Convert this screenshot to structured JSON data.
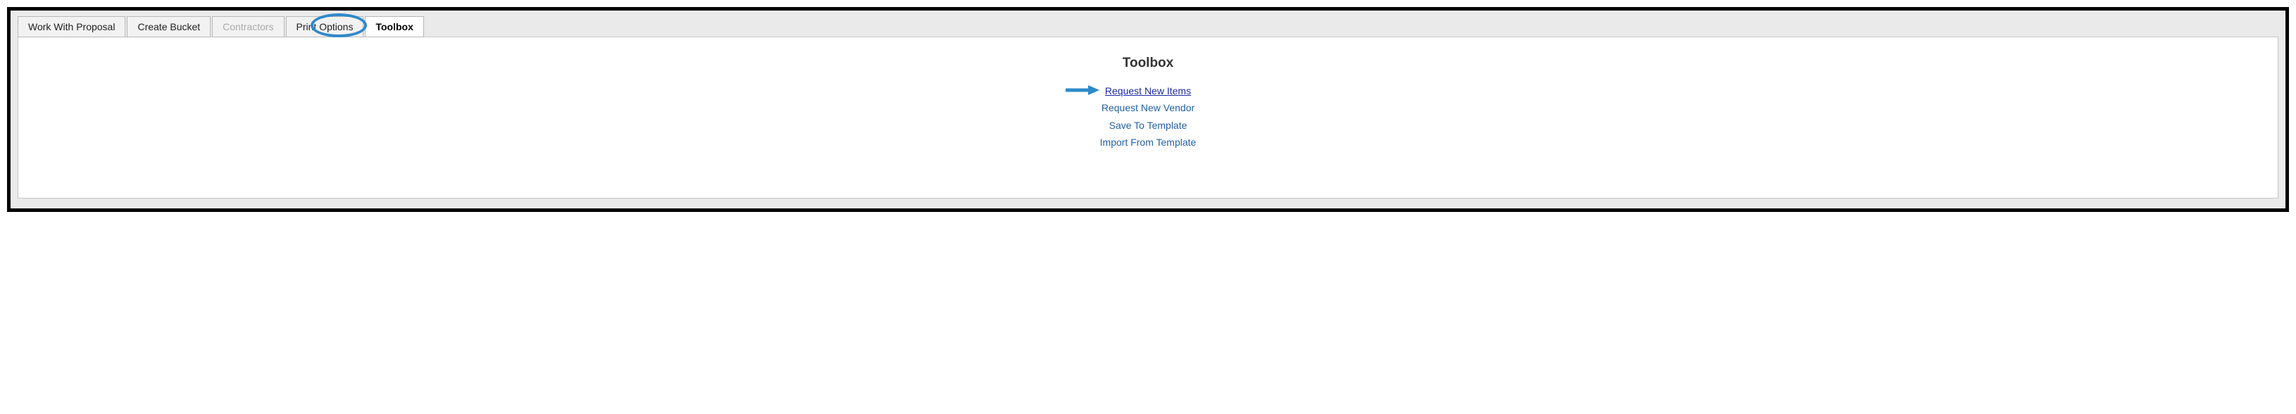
{
  "tabs": [
    {
      "label": "Work With Proposal",
      "state": "normal"
    },
    {
      "label": "Create Bucket",
      "state": "normal"
    },
    {
      "label": "Contractors",
      "state": "disabled"
    },
    {
      "label": "Print Options",
      "state": "normal"
    },
    {
      "label": "Toolbox",
      "state": "active"
    }
  ],
  "panel": {
    "title": "Toolbox",
    "links": [
      {
        "label": "Request New Items",
        "emph": true
      },
      {
        "label": "Request New Vendor",
        "emph": false
      },
      {
        "label": "Save To Template",
        "emph": false
      },
      {
        "label": "Import From Template",
        "emph": false
      }
    ]
  },
  "annotations": {
    "highlight_tab_index": 4,
    "arrow_link_index": 0,
    "arrow_color": "#2f89c9",
    "oval_color": "#2f89c9"
  }
}
